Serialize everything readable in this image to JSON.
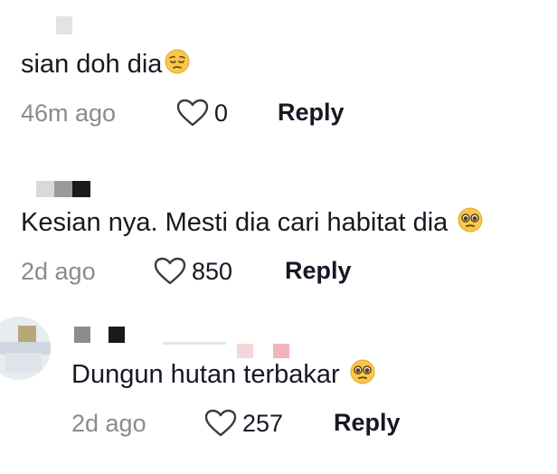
{
  "comments": [
    {
      "text": "sian doh dia",
      "emoji_icon": "pensive-face-emoji",
      "timestamp": "46m ago",
      "likes": "0",
      "reply_label": "Reply"
    },
    {
      "text": "Kesian nya. Mesti dia cari habitat dia ",
      "emoji_icon": "pleading-face-emoji",
      "timestamp": "2d ago",
      "likes": "850",
      "reply_label": "Reply"
    },
    {
      "text": "Dungun hutan terbakar ",
      "emoji_icon": "pleading-face-emoji",
      "timestamp": "2d ago",
      "likes": "257",
      "reply_label": "Reply"
    }
  ],
  "icons": {
    "like": "heart-outline-icon"
  },
  "colors": {
    "text": "#161823",
    "muted": "#8a8b91",
    "background": "#ffffff"
  }
}
